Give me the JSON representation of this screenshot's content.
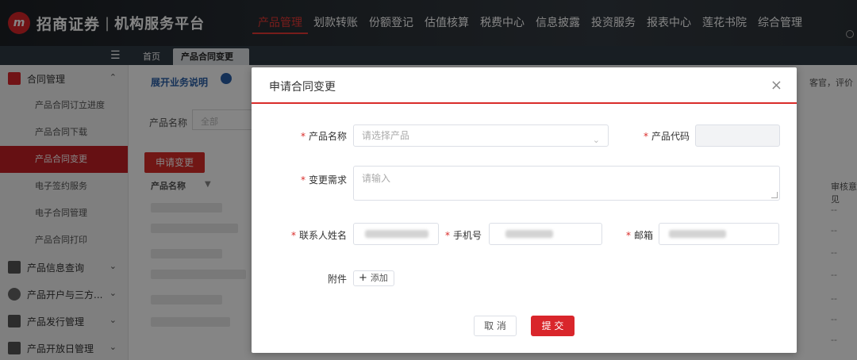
{
  "brand": {
    "mark": "m",
    "name": "招商证券",
    "sub": "机构服务平台"
  },
  "nav": [
    "产品管理",
    "划款转账",
    "份额登记",
    "估值核算",
    "税费中心",
    "信息披露",
    "投资服务",
    "报表中心",
    "莲花书院",
    "综合管理"
  ],
  "tabs": {
    "home": "首页",
    "current": "产品合同变更",
    "close": "x"
  },
  "sidebar": {
    "group_contract": "合同管理",
    "items": [
      "产品合同订立进度",
      "产品合同下载",
      "产品合同变更",
      "电子签约服务",
      "电子合同管理",
      "产品合同打印"
    ],
    "groups": [
      "产品信息查询",
      "产品开户与三方...",
      "产品发行管理",
      "产品开放日管理"
    ]
  },
  "background": {
    "link": "展开业务说明",
    "product_name_label": "产品名称",
    "product_name_placeholder": "全部",
    "apply_button": "申请变更",
    "column_product": "产品名称",
    "column_review": "审核意见",
    "right_text": "客官，评价",
    "dash": "--"
  },
  "modal": {
    "title": "申请合同变更",
    "product_name_label": "产品名称",
    "product_name_placeholder": "请选择产品",
    "product_code_label": "产品代码",
    "change_label": "变更需求",
    "change_placeholder": "请输入",
    "contact_label": "联系人姓名",
    "phone_label": "手机号",
    "email_label": "邮箱",
    "attachment_label": "附件",
    "add_label": "添加",
    "cancel": "取 消",
    "submit": "提 交"
  },
  "colors": {
    "accent": "#d92c2a",
    "header_bg": "#2a3036",
    "tab_bg": "#2f3a44"
  }
}
